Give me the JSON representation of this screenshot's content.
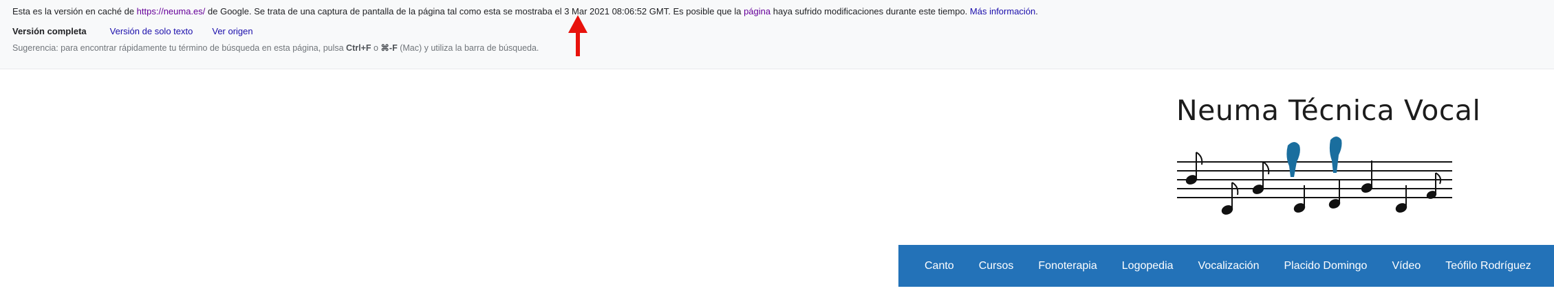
{
  "cache": {
    "text_before_url": "Esta es la versión en caché de ",
    "url": "https://neuma.es/",
    "text_after_url": " de Google. Se trata de una captura de pantalla de la página tal como esta se mostraba el 3 Mar 2021 08:06:52 GMT. Es posible que la ",
    "page_link": "página",
    "text_after_page": " haya sufrido modificaciones durante este tiempo. ",
    "more_info": "Más información",
    "text_end": ".",
    "links": {
      "full_version": "Versión completa",
      "text_only": "Versión de solo texto",
      "view_source": "Ver origen"
    },
    "tip": {
      "text_before": "Sugerencia: para encontrar rápidamente tu término de búsqueda en esta página, pulsa ",
      "key1": "Ctrl+F",
      "text_or": " o ",
      "key2": "⌘-F",
      "text_after": " (Mac) y utiliza la barra de búsqueda."
    }
  },
  "annotation": {
    "arrow_color": "#e8120c"
  },
  "site": {
    "title": "Neuma Técnica Vocal",
    "nav": [
      "Canto",
      "Cursos",
      "Fonoterapia",
      "Logopedia",
      "Vocalización",
      "Placido Domingo",
      "Vídeo",
      "Teófilo Rodríguez"
    ],
    "nav_color": "#2372b8",
    "bird_color": "#1a6e9e"
  }
}
